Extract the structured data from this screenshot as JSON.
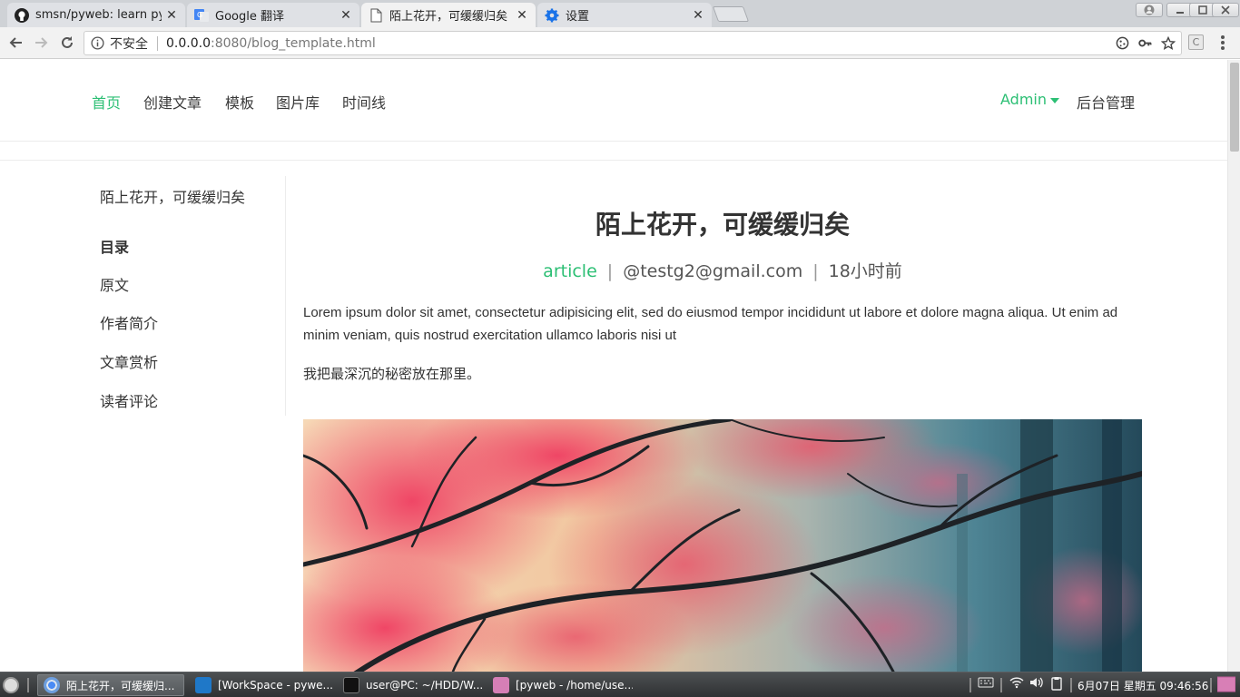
{
  "browser": {
    "tabs": [
      {
        "title": "smsn/pyweb: learn py",
        "icon": "github-icon"
      },
      {
        "title": "Google 翻译",
        "icon": "google-translate-icon"
      },
      {
        "title": "陌上花开，可缓缓归矣",
        "icon": "page-icon"
      },
      {
        "title": "设置",
        "icon": "settings-gear-icon"
      }
    ],
    "close_glyph": "✕",
    "address": {
      "security": "不安全",
      "host": "0.0.0.0",
      "path": ":8080/blog_template.html"
    },
    "extension_label": "C"
  },
  "site": {
    "nav": {
      "items": [
        "首页",
        "创建文章",
        "模板",
        "图片库",
        "时间线"
      ],
      "active_index": 0,
      "user": "Admin",
      "admin_link": "后台管理"
    },
    "sidebar": {
      "title": "陌上花开，可缓缓归矣",
      "toc_heading": "目录",
      "toc_items": [
        "原文",
        "作者简介",
        "文章赏析",
        "读者评论"
      ]
    },
    "article": {
      "title": "陌上花开，可缓缓归矣",
      "category": "article",
      "author": "@testg2@gmail.com",
      "time": "18小时前",
      "separator": "|",
      "paragraphs": [
        "Lorem ipsum dolor sit amet, consectetur adipisicing elit, sed do eiusmod tempor incididunt ut labore et dolore magna aliqua. Ut enim ad minim veniam, quis nostrud exercitation ullamco laboris nisi ut",
        "我把最深沉的秘密放在那里。"
      ],
      "image": "red-autumn-tree-branches-in-misty-forest"
    },
    "colors": {
      "accent": "#2cbf74",
      "text": "#333333"
    }
  },
  "taskbar": {
    "tasks": [
      {
        "label": "陌上花开，可缓缓归...",
        "icon": "chrome-icon",
        "active": true
      },
      {
        "label": "[WorkSpace - pywe...",
        "icon": "vscode-icon",
        "active": false
      },
      {
        "label": "user@PC: ~/HDD/W...",
        "icon": "terminal-icon",
        "active": false
      },
      {
        "label": "[pyweb - /home/use...",
        "icon": "folder-icon",
        "active": false
      }
    ],
    "clock": "6月07日 星期五 09:46:56"
  }
}
